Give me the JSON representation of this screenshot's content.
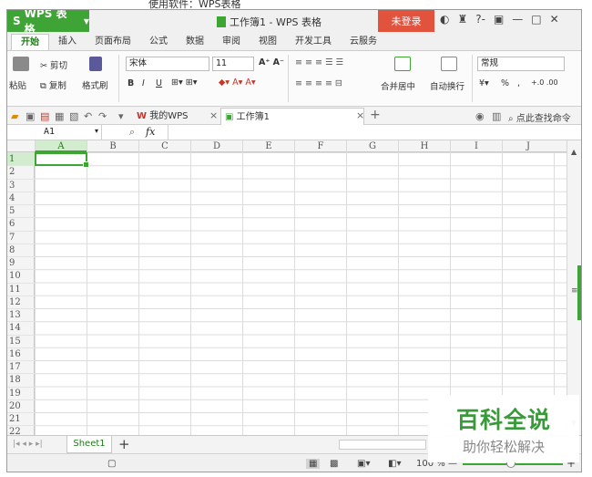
{
  "caption": "使用软件：WPS表格",
  "app": {
    "name": "WPS 表格",
    "window_title": "工作簿1 - WPS 表格",
    "login": "未登录",
    "window_controls": [
      "?-",
      "▣",
      "—",
      "□",
      "✕"
    ]
  },
  "ribbon_tabs": [
    "开始",
    "插入",
    "页面布局",
    "公式",
    "数据",
    "审阅",
    "视图",
    "开发工具",
    "云服务"
  ],
  "ribbon": {
    "paste": "粘贴",
    "cut": "剪切",
    "copy": "复制",
    "format_painter": "格式刷",
    "font": "宋体",
    "size": "11",
    "bold": "B",
    "italic": "I",
    "underline": "U",
    "merge": "合并居中",
    "wrap": "自动换行",
    "num_format": "常规",
    "percent": "%",
    "comma": ","
  },
  "quick": {
    "doc_tabs": [
      {
        "label": "我的WPS"
      },
      {
        "label": "工作簿1"
      }
    ],
    "find": "点此查找命令",
    "new_tab": "+"
  },
  "formula": {
    "cell_ref": "A1",
    "fx": "fx"
  },
  "columns": [
    "A",
    "B",
    "C",
    "D",
    "E",
    "F",
    "G",
    "H",
    "I",
    "J"
  ],
  "rows": [
    "1",
    "2",
    "3",
    "4",
    "5",
    "6",
    "7",
    "8",
    "9",
    "10",
    "11",
    "12",
    "13",
    "14",
    "15",
    "16",
    "17",
    "18",
    "19",
    "20",
    "21",
    "22"
  ],
  "sheet": {
    "tab": "Sheet1",
    "add": "+"
  },
  "status": {
    "zoom": "100 %",
    "minus": "—",
    "plus": "+"
  },
  "watermark": {
    "title": "百科全说",
    "subtitle": "助你轻松解决"
  },
  "colors": {
    "brand": "#3fa436",
    "login": "#e2533e"
  }
}
